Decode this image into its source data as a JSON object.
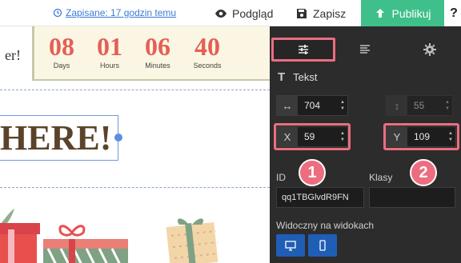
{
  "topbar": {
    "saved_label": "Zapisane: 17 godzin temu",
    "preview_label": "Podgląd",
    "save_label": "Zapisz",
    "publish_label": "Publikuj",
    "help_label": "?",
    "publish_color": "#3fc08a"
  },
  "canvas": {
    "partial_text": "er!",
    "headline": "HERE!",
    "countdown": [
      {
        "value": "08",
        "label": "Days"
      },
      {
        "value": "01",
        "label": "Hours"
      },
      {
        "value": "06",
        "label": "Minutes"
      },
      {
        "value": "40",
        "label": "Seconds"
      }
    ]
  },
  "panel": {
    "tabs": [
      {
        "icon": "sliders-icon",
        "active": true
      },
      {
        "icon": "align-text-icon",
        "active": false
      },
      {
        "icon": "gear-icon",
        "active": false
      }
    ],
    "section_title": "Tekst",
    "width_value": "704",
    "height_value": "55",
    "x_label": "X",
    "x_value": "59",
    "y_label": "Y",
    "y_value": "109",
    "id_label": "ID",
    "id_value": "qq1TBGlvdR9FN",
    "classes_label": "Klasy",
    "visibility_label": "Widoczny na widokach",
    "badges": [
      "1",
      "2"
    ],
    "highlight_color": "#ec6d7f",
    "accent_color": "#1f5eb5"
  }
}
